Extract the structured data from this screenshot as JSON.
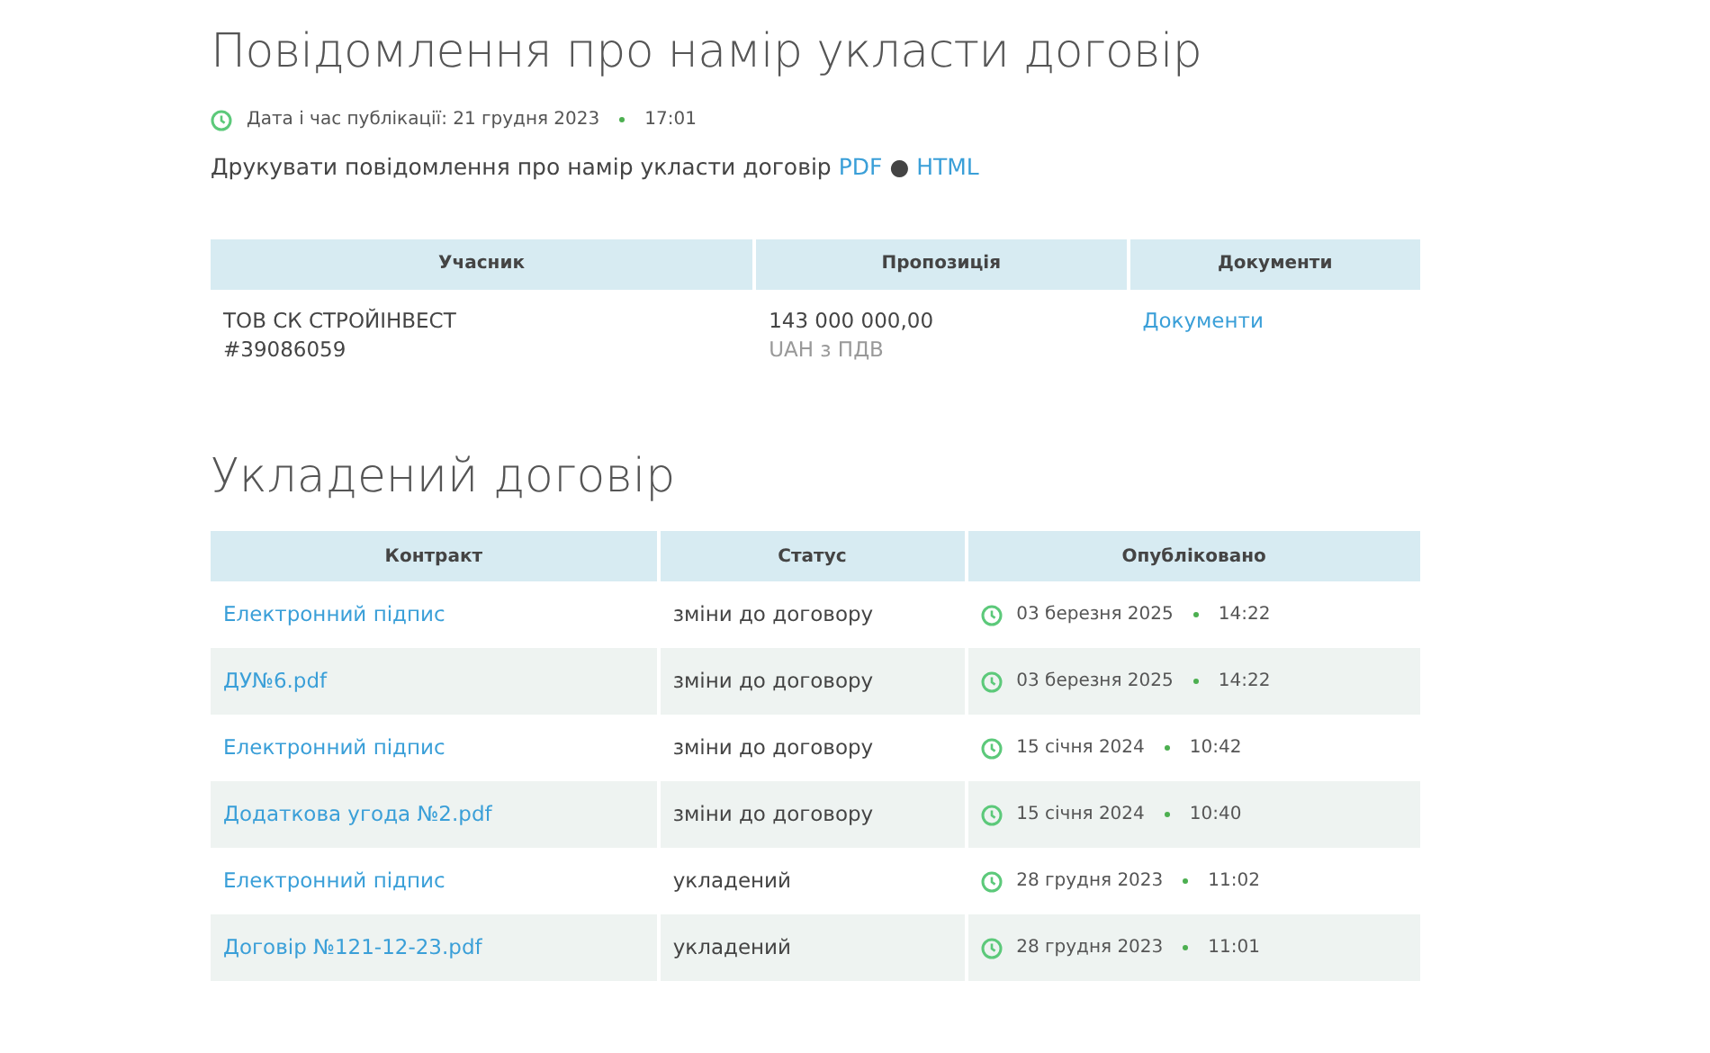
{
  "notice": {
    "title": "Повідомлення про намір укласти договір",
    "published": {
      "label": "Дата і час публікації: 21 грудня 2023",
      "time": "17:01"
    },
    "print": {
      "text": "Друкувати повідомлення про намір укласти договір",
      "links": [
        "PDF",
        "HTML"
      ],
      "separator": "●"
    }
  },
  "offers_table": {
    "columns": [
      "Учасник",
      "Пропозиція",
      "Документи"
    ],
    "rows": [
      {
        "participant": "ТОВ СК СТРОЙІНВЕСТ",
        "code": "#39086059",
        "amount": "143 000 000,00",
        "currency": "UAH з ПДВ",
        "documents": "Документи"
      }
    ]
  },
  "contract_section": {
    "title": "Укладений договір",
    "columns": [
      "Контракт",
      "Статус",
      "Опубліковано"
    ],
    "rows": [
      {
        "contract": "Електронний підпис",
        "status": "зміни до договору",
        "date": "03 березня 2025",
        "time": "14:22"
      },
      {
        "contract": "ДУ№6.pdf",
        "status": "зміни до договору",
        "date": "03 березня 2025",
        "time": "14:22"
      },
      {
        "contract": "Електронний підпис",
        "status": "зміни до договору",
        "date": "15 січня 2024",
        "time": "10:42"
      },
      {
        "contract": "Додаткова угода №2.pdf",
        "status": "зміни до договору",
        "date": "15 січня 2024",
        "time": "10:40"
      },
      {
        "contract": "Електронний підпис",
        "status": "укладений",
        "date": "28 грудня 2023",
        "time": "11:02"
      },
      {
        "contract": "Договір №121-12-23.pdf",
        "status": "укладений",
        "date": "28 грудня 2023",
        "time": "11:01"
      }
    ]
  }
}
